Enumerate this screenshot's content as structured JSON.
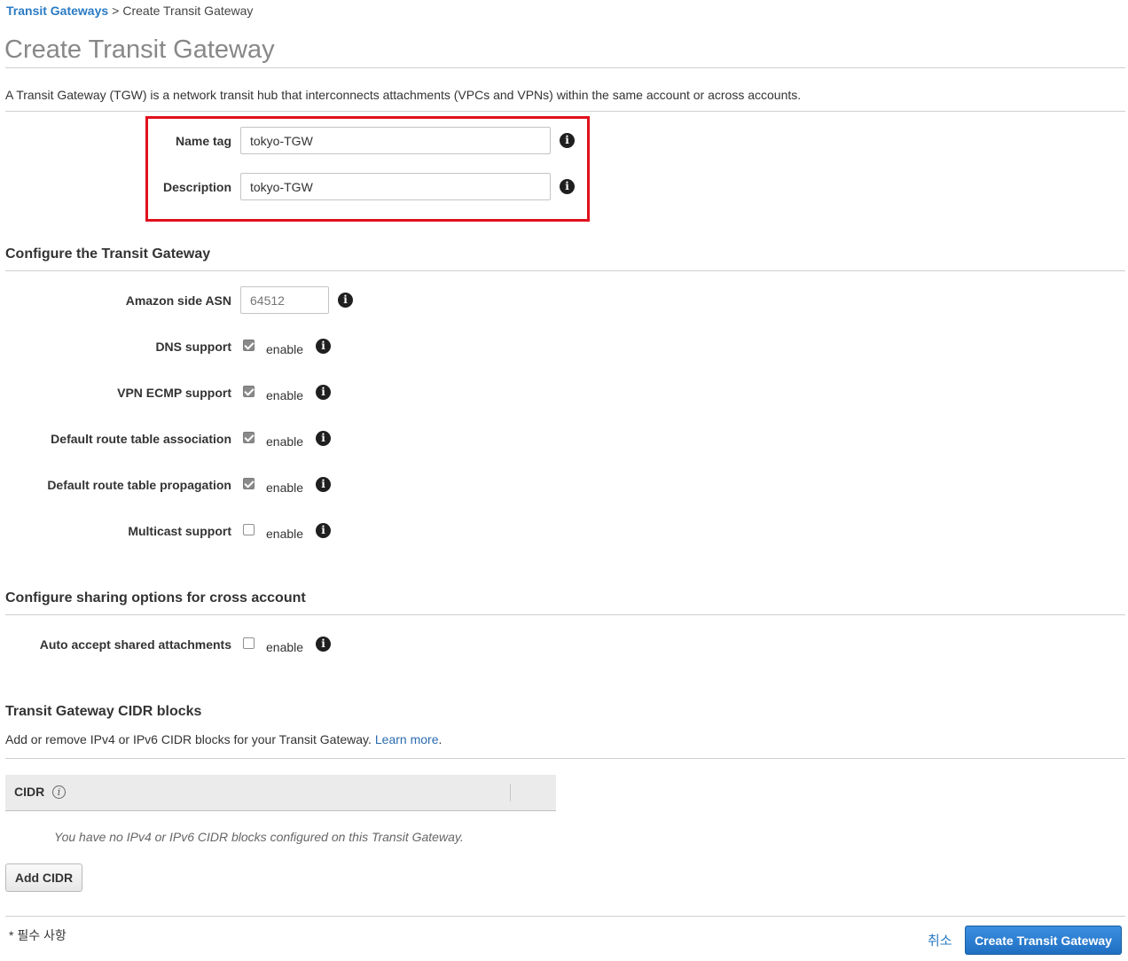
{
  "breadcrumb": {
    "parent": "Transit Gateways",
    "separator": ">",
    "current": "Create Transit Gateway"
  },
  "page": {
    "title": "Create Transit Gateway",
    "intro": "A Transit Gateway (TGW) is a network transit hub that interconnects attachments (VPCs and VPNs) within the same account or across accounts."
  },
  "basic": {
    "name_tag": {
      "label": "Name tag",
      "value": "tokyo-TGW"
    },
    "description": {
      "label": "Description",
      "value": "tokyo-TGW"
    }
  },
  "configure": {
    "heading": "Configure the Transit Gateway",
    "asn": {
      "label": "Amazon side ASN",
      "placeholder": "64512"
    },
    "options": [
      {
        "label": "DNS support",
        "checked": true,
        "text": "enable"
      },
      {
        "label": "VPN ECMP support",
        "checked": true,
        "text": "enable"
      },
      {
        "label": "Default route table association",
        "checked": true,
        "text": "enable"
      },
      {
        "label": "Default route table propagation",
        "checked": true,
        "text": "enable"
      },
      {
        "label": "Multicast support",
        "checked": false,
        "text": "enable"
      }
    ]
  },
  "sharing": {
    "heading": "Configure sharing options for cross account",
    "auto_accept": {
      "label": "Auto accept shared attachments",
      "checked": false,
      "text": "enable"
    }
  },
  "cidr": {
    "heading": "Transit Gateway CIDR blocks",
    "description": "Add or remove IPv4 or IPv6 CIDR blocks for your Transit Gateway.",
    "learn_more": "Learn more",
    "learn_more_suffix": ".",
    "column_header": "CIDR",
    "empty_message": "You have no IPv4 or IPv6 CIDR blocks configured on this Transit Gateway.",
    "add_button": "Add CIDR"
  },
  "footer": {
    "required_note": "* 필수 사항",
    "cancel": "취소",
    "submit": "Create Transit Gateway"
  },
  "icons": {
    "info": "info-icon",
    "checkbox": "checkbox"
  },
  "colors": {
    "link": "#2b7bc4",
    "primary": "#1f6fc2",
    "highlight": "#e0101d"
  }
}
